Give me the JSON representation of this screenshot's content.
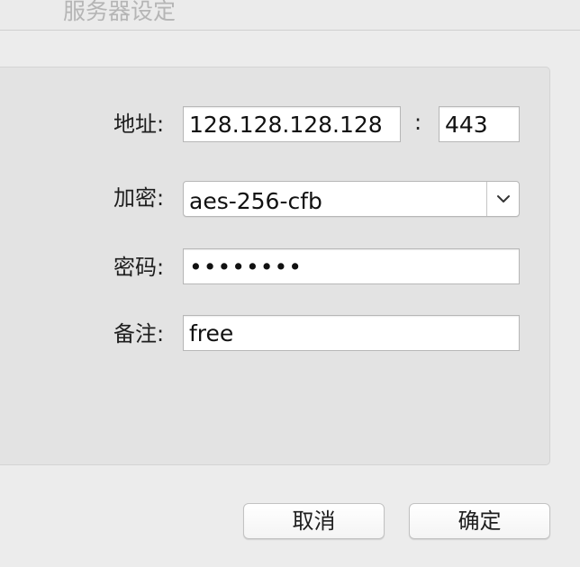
{
  "window": {
    "title": "服务器设定"
  },
  "form": {
    "address_label": "地址:",
    "address_value": "128.128.128.128",
    "port_separator": ":",
    "port_value": "443",
    "encryption_label": "加密:",
    "encryption_value": "aes-256-cfb",
    "password_label": "密码:",
    "password_value": "••••••••",
    "remark_label": "备注:",
    "remark_value": "free"
  },
  "buttons": {
    "cancel_label": "取消",
    "ok_label": "确定"
  }
}
